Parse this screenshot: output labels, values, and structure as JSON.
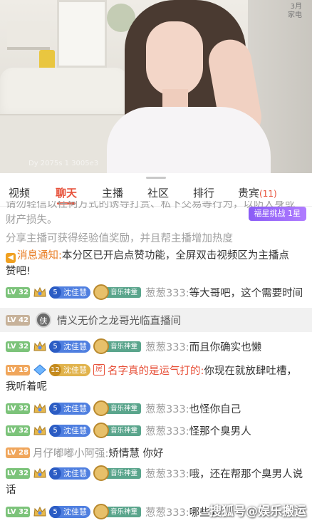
{
  "video": {
    "corner_text_1": "3月",
    "corner_text_2": "家电",
    "overlay_text": "Dy 2075s 1 3005e3"
  },
  "tabs": [
    {
      "label": "视频"
    },
    {
      "label": "聊天"
    },
    {
      "label": "主播"
    },
    {
      "label": "社区"
    },
    {
      "label": "排行"
    },
    {
      "label": "贵宾",
      "count": "(11)"
    }
  ],
  "chat": {
    "warning_line1": "请勿轻信以任何方式的诱导打赏、私下交易等行为，以防人身或",
    "warning_line2": "财产损失。",
    "event_pill": "福星挑战 1星",
    "exp_hint": "分享主播可获得经验值奖励，并且帮主播增加热度",
    "notice_icon": "◀",
    "notice_title": "消息通知:",
    "notice_body_1": "本分区已开启点赞功能，全屏双击视频区为主播点",
    "notice_body_2": "赞吧!",
    "messages": [
      {
        "lv": "LV 32",
        "fan": "沈佳慧",
        "fan_lv": "5",
        "medal": "音乐神童",
        "user": "葱葱333:",
        "text": "等大哥吧，这个需要时间"
      },
      {
        "lv": "LV 32",
        "fan": "沈佳慧",
        "fan_lv": "5",
        "medal": "音乐神童",
        "user": "葱葱333:",
        "text": "而且你确实也懒"
      },
      {
        "lv": "LV 32",
        "fan": "沈佳慧",
        "fan_lv": "5",
        "medal": "音乐神童",
        "user": "葱葱333:",
        "text": "也怪你自己"
      },
      {
        "lv": "LV 32",
        "fan": "沈佳慧",
        "fan_lv": "5",
        "medal": "音乐神童",
        "user": "葱葱333:",
        "text": "怪那个臭男人"
      },
      {
        "lv": "LV 32",
        "fan": "沈佳慧",
        "fan_lv": "5",
        "medal": "音乐神童",
        "user": "葱葱333:",
        "text": "哦，还在帮那个臭男人说",
        "text2": "话"
      },
      {
        "lv": "LV 32",
        "fan": "沈佳慧",
        "fan_lv": "5",
        "medal": "音乐神童",
        "user": "葱葱333:",
        "text": "哪些人"
      }
    ],
    "vip_entry": {
      "lv": "LV 42",
      "badge": "侠",
      "text": "情义无价之龙哥光临直播间"
    },
    "special_msg": {
      "lv": "LV 19",
      "fan": "沈佳慧",
      "fan_lv": "12",
      "room_tag": "房",
      "user": "名字真的是运气打的:",
      "text": "你现在就放肆吐槽，",
      "text2": "我听着呢"
    },
    "plain_msg": {
      "lv": "LV 28",
      "user": "月仔嘟嘟小阿强:",
      "text": "矫情慧 你好"
    },
    "watermark": "搜狐号@娱乐搬运"
  }
}
